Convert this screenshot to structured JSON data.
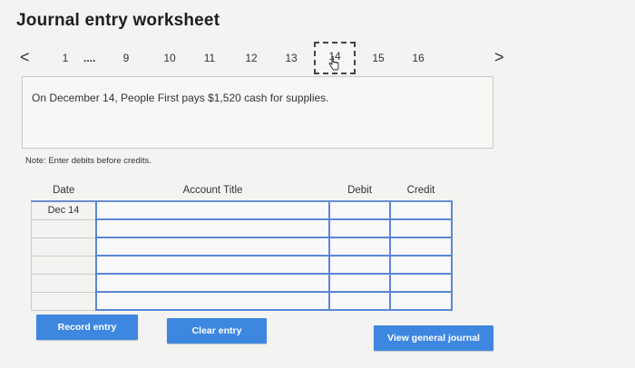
{
  "title": "Journal entry worksheet",
  "nav": {
    "prev": "<",
    "next": ">",
    "pages": [
      "1",
      "9",
      "10",
      "11",
      "12",
      "13",
      "14",
      "15",
      "16"
    ],
    "dots": "....",
    "active": "14"
  },
  "question": "On December 14, People First pays $1,520 cash for supplies.",
  "note": "Note: Enter debits before credits.",
  "table": {
    "headers": {
      "date": "Date",
      "account": "Account Title",
      "debit": "Debit",
      "credit": "Credit"
    },
    "rows": [
      {
        "date": "Dec 14",
        "account": "",
        "debit": "",
        "credit": ""
      },
      {
        "date": "",
        "account": "",
        "debit": "",
        "credit": ""
      },
      {
        "date": "",
        "account": "",
        "debit": "",
        "credit": ""
      },
      {
        "date": "",
        "account": "",
        "debit": "",
        "credit": ""
      },
      {
        "date": "",
        "account": "",
        "debit": "",
        "credit": ""
      },
      {
        "date": "",
        "account": "",
        "debit": "",
        "credit": ""
      }
    ]
  },
  "buttons": {
    "record": "Record entry",
    "clear": "Clear entry",
    "view": "View general journal"
  },
  "colors": {
    "accent": "#3d87e0",
    "cell_border": "#5b86d6"
  }
}
